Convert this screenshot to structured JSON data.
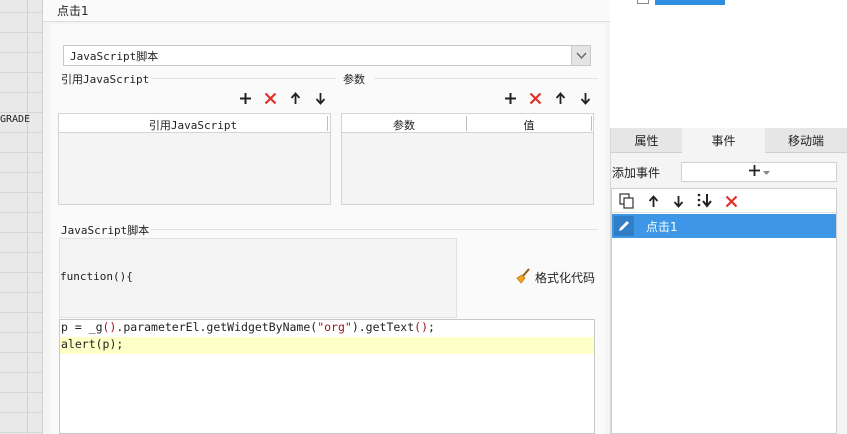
{
  "sheet": {
    "row_label": "GRADE"
  },
  "dialog": {
    "title": "点击1",
    "script_type": {
      "value": "JavaScript脚本",
      "icon": "chevron-down-icon"
    },
    "ref_js": {
      "label": "引用JavaScript",
      "column": "引用JavaScript",
      "toolbar": [
        "add-icon",
        "delete-icon",
        "move-up-icon",
        "move-down-icon"
      ]
    },
    "params": {
      "label": "参数",
      "columns": [
        "参数",
        "值"
      ],
      "toolbar": [
        "add-icon",
        "delete-icon",
        "move-up-icon",
        "move-down-icon"
      ]
    },
    "script_section": {
      "label": "JavaScript脚本",
      "function_header": "function(){",
      "format_button": "格式化代码",
      "code_lines": [
        {
          "parts": [
            "p = _g",
            "()",
            ".parameterEl.getWidgetByName(",
            "\"org\"",
            ").getText",
            "()",
            ";"
          ]
        },
        {
          "parts": [
            "alert(p);"
          ]
        }
      ]
    }
  },
  "right_panel": {
    "tabs": [
      "属性",
      "事件",
      "移动端"
    ],
    "active_tab": "事件",
    "add_event_label": "添加事件",
    "events_toolbar": [
      "copy-icon",
      "move-up-icon",
      "move-down-icon",
      "move-bottom-icon",
      "delete-icon"
    ],
    "events": [
      "点击1"
    ]
  },
  "colors": {
    "accent": "#3d97e6",
    "delete_red": "#e0302a",
    "highlight_line": "#ffffc8",
    "string": "#a31515"
  }
}
